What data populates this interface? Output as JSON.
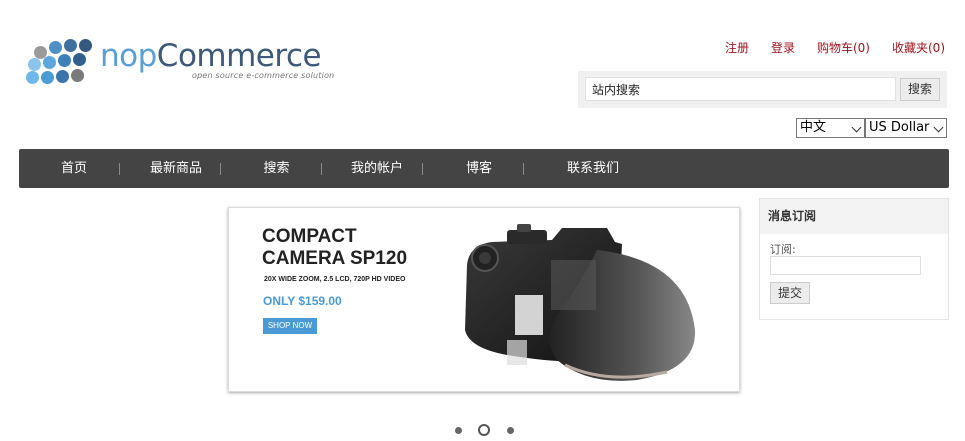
{
  "logo": {
    "wordmark_prefix": "nop",
    "wordmark_suffix": "Commerce",
    "tagline": "open source e-commerce solution"
  },
  "header_links": {
    "register": "注册",
    "login": "登录",
    "cart": "购物车",
    "cart_count": "(0)",
    "wishlist": "收藏夹",
    "wishlist_count": "(0)"
  },
  "search": {
    "value": "站内搜索",
    "button_label": "搜索"
  },
  "selectors": {
    "language": "中文",
    "currency": "US Dollar"
  },
  "menu": {
    "items": [
      {
        "label": "首页"
      },
      {
        "label": "最新商品"
      },
      {
        "label": "搜索"
      },
      {
        "label": "我的帐户"
      },
      {
        "label": "博客"
      },
      {
        "label": "联系我们"
      }
    ]
  },
  "slider": {
    "title_line1": "COMPACT",
    "title_line2": "CAMERA SP120",
    "subtitle": "20X WIDE ZOOM, 2.5 LCD, 720P HD VIDEO",
    "price": "ONLY $159.00",
    "cta": "SHOP NOW",
    "slide_count": 3,
    "active_slide": 2
  },
  "newsletter": {
    "title": "消息订阅",
    "label": "订阅:",
    "button_label": "提交"
  },
  "colors": {
    "link_red": "#a0141e",
    "menu_bg": "#444444",
    "accent_blue": "#4a9ad6"
  }
}
